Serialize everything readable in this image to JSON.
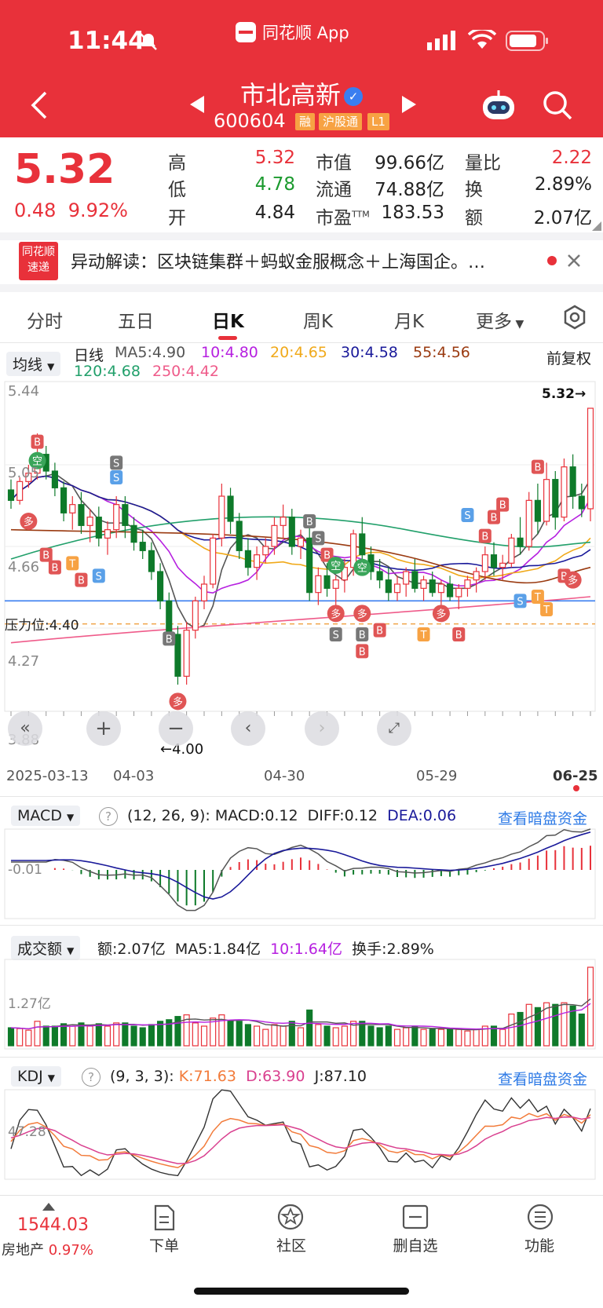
{
  "status": {
    "time": "11:44",
    "app_label": "同花顺 App"
  },
  "header": {
    "stock_name": "市北高新",
    "stock_code": "600604",
    "tags": [
      "融",
      "沪股通",
      "L1"
    ]
  },
  "quote": {
    "price": "5.32",
    "change": "0.48",
    "change_pct": "9.92%",
    "fields": [
      {
        "label": "高",
        "value": "5.32",
        "color": "#e8313a"
      },
      {
        "label": "低",
        "value": "4.78",
        "color": "#1b9a2e"
      },
      {
        "label": "开",
        "value": "4.84",
        "color": "#222222"
      },
      {
        "label": "市值",
        "value": "99.66亿",
        "color": "#222222"
      },
      {
        "label": "流通",
        "value": "74.88亿",
        "color": "#222222"
      },
      {
        "label": "市盈TTM",
        "value": "183.53",
        "color": "#222222"
      },
      {
        "label": "量比",
        "value": "2.22",
        "color": "#e8313a"
      },
      {
        "label": "换",
        "value": "2.89%",
        "color": "#222222"
      },
      {
        "label": "额",
        "value": "2.07亿",
        "color": "#222222"
      }
    ]
  },
  "news": {
    "logo_top": "同花顺",
    "logo_bottom": "速递",
    "text": "异动解读：区块链集群＋蚂蚁金服概念＋上海国企。…"
  },
  "tabs": [
    "分时",
    "五日",
    "日K",
    "周K",
    "月K",
    "更多"
  ],
  "kchart": {
    "selector": "均线",
    "title": "日线",
    "ma": [
      {
        "label": "MA5:4.90",
        "color": "#555555"
      },
      {
        "label": "10:4.80",
        "color": "#b620e0"
      },
      {
        "label": "20:4.65",
        "color": "#f0a91a"
      },
      {
        "label": "30:4.58",
        "color": "#1a1a9a"
      },
      {
        "label": "55:4.56",
        "color": "#9a3a10"
      },
      {
        "label": "120:4.68",
        "color": "#22a06b"
      },
      {
        "label": "250:4.42",
        "color": "#ef5b8a"
      }
    ],
    "adjust": "前复权",
    "y_ticks": [
      "5.44",
      "5.05",
      "4.66",
      "4.27",
      "3.88"
    ],
    "pressure_label": "压力位:4.40",
    "last_price_label": "5.32",
    "low_label": "4.00",
    "dates": [
      "2025-03-13",
      "04-03",
      "04-30",
      "05-29",
      "06-25"
    ]
  },
  "chart_data": {
    "type": "candlestick",
    "ylim": [
      3.88,
      5.44
    ],
    "candles": [
      [
        4.93,
        4.98,
        4.84,
        4.88
      ],
      [
        4.88,
        4.99,
        4.86,
        4.97
      ],
      [
        4.97,
        5.05,
        4.94,
        5.01
      ],
      [
        5.01,
        5.2,
        4.98,
        5.1
      ],
      [
        5.1,
        5.14,
        4.98,
        5.02
      ],
      [
        5.02,
        5.06,
        4.9,
        4.94
      ],
      [
        4.94,
        4.97,
        4.78,
        4.82
      ],
      [
        4.82,
        4.9,
        4.74,
        4.86
      ],
      [
        4.86,
        4.92,
        4.72,
        4.76
      ],
      [
        4.76,
        4.84,
        4.68,
        4.8
      ],
      [
        4.8,
        4.85,
        4.66,
        4.7
      ],
      [
        4.7,
        4.78,
        4.62,
        4.74
      ],
      [
        4.74,
        4.9,
        4.7,
        4.86
      ],
      [
        4.86,
        4.9,
        4.7,
        4.76
      ],
      [
        4.76,
        4.8,
        4.64,
        4.68
      ],
      [
        4.68,
        4.74,
        4.6,
        4.64
      ],
      [
        4.64,
        4.68,
        4.5,
        4.54
      ],
      [
        4.54,
        4.58,
        4.36,
        4.4
      ],
      [
        4.4,
        4.44,
        4.2,
        4.24
      ],
      [
        4.24,
        4.28,
        4.0,
        4.04
      ],
      [
        4.04,
        4.3,
        4.0,
        4.26
      ],
      [
        4.26,
        4.42,
        4.22,
        4.4
      ],
      [
        4.4,
        4.52,
        4.36,
        4.48
      ],
      [
        4.48,
        4.72,
        4.46,
        4.7
      ],
      [
        4.7,
        4.96,
        4.66,
        4.9
      ],
      [
        4.9,
        4.94,
        4.72,
        4.78
      ],
      [
        4.78,
        4.82,
        4.6,
        4.64
      ],
      [
        4.64,
        4.7,
        4.52,
        4.56
      ],
      [
        4.56,
        4.66,
        4.5,
        4.62
      ],
      [
        4.62,
        4.7,
        4.58,
        4.66
      ],
      [
        4.66,
        4.8,
        4.62,
        4.76
      ],
      [
        4.76,
        4.86,
        4.7,
        4.8
      ],
      [
        4.8,
        4.84,
        4.62,
        4.66
      ],
      [
        4.66,
        4.74,
        4.6,
        4.7
      ],
      [
        4.7,
        4.76,
        4.4,
        4.44
      ],
      [
        4.44,
        4.56,
        4.38,
        4.52
      ],
      [
        4.52,
        4.58,
        4.42,
        4.46
      ],
      [
        4.46,
        4.52,
        4.38,
        4.5
      ],
      [
        4.5,
        4.6,
        4.44,
        4.56
      ],
      [
        4.56,
        4.74,
        4.52,
        4.72
      ],
      [
        4.72,
        4.8,
        4.58,
        4.62
      ],
      [
        4.62,
        4.66,
        4.5,
        4.54
      ],
      [
        4.54,
        4.6,
        4.46,
        4.5
      ],
      [
        4.5,
        4.56,
        4.4,
        4.44
      ],
      [
        4.44,
        4.52,
        4.4,
        4.48
      ],
      [
        4.48,
        4.56,
        4.42,
        4.54
      ],
      [
        4.54,
        4.6,
        4.44,
        4.46
      ],
      [
        4.46,
        4.52,
        4.4,
        4.5
      ],
      [
        4.5,
        4.54,
        4.42,
        4.44
      ],
      [
        4.44,
        4.5,
        4.38,
        4.48
      ],
      [
        4.48,
        4.52,
        4.4,
        4.42
      ],
      [
        4.42,
        4.48,
        4.36,
        4.46
      ],
      [
        4.46,
        4.52,
        4.42,
        4.5
      ],
      [
        4.5,
        4.56,
        4.44,
        4.54
      ],
      [
        4.54,
        4.66,
        4.5,
        4.62
      ],
      [
        4.62,
        4.68,
        4.52,
        4.56
      ],
      [
        4.56,
        4.62,
        4.5,
        4.58
      ],
      [
        4.58,
        4.72,
        4.56,
        4.7
      ],
      [
        4.7,
        4.8,
        4.62,
        4.66
      ],
      [
        4.66,
        4.92,
        4.64,
        4.88
      ],
      [
        4.88,
        4.96,
        4.72,
        4.78
      ],
      [
        4.78,
        5.06,
        4.76,
        4.98
      ],
      [
        4.98,
        5.02,
        4.74,
        4.8
      ],
      [
        4.8,
        5.08,
        4.78,
        5.04
      ],
      [
        5.04,
        5.1,
        4.84,
        4.9
      ],
      [
        4.9,
        4.96,
        4.8,
        4.84
      ],
      [
        4.84,
        5.32,
        4.78,
        5.32
      ]
    ]
  },
  "macd": {
    "selector": "MACD",
    "params": "(12, 26, 9):",
    "macd": "MACD:0.12",
    "diff": "DIFF:0.12",
    "dea": "DEA:0.06",
    "link": "查看暗盘资金",
    "y_tick": "-0.01"
  },
  "volume": {
    "selector": "成交额",
    "amount": "额:2.07亿",
    "ma5": "MA5:1.84亿",
    "ma10": "10:1.64亿",
    "turnover": "换手:2.89%",
    "y_tick": "1.27亿"
  },
  "kdj": {
    "selector": "KDJ",
    "params": "(9, 3, 3):",
    "k": "K:71.63",
    "d": "D:63.90",
    "j": "J:87.10",
    "link": "查看暗盘资金",
    "y_tick": "47.28"
  },
  "bottom": {
    "index_value": "1544.03",
    "index_name": "房地产",
    "index_pct": "0.97%",
    "nav": [
      "下单",
      "社区",
      "删自选",
      "功能"
    ]
  }
}
